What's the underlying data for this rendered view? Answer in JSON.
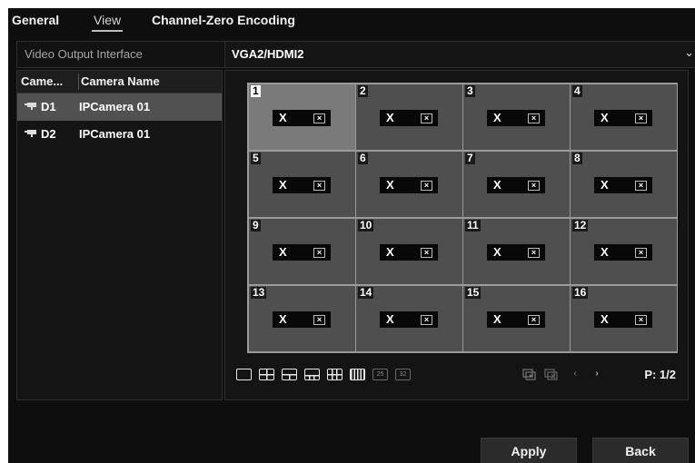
{
  "tabs": [
    {
      "label": "General"
    },
    {
      "label": "View"
    },
    {
      "label": "Channel-Zero Encoding"
    }
  ],
  "output": {
    "label": "Video Output Interface",
    "value": "VGA2/HDMI2"
  },
  "camera_list": {
    "col_no": "Came...",
    "col_name": "Camera Name",
    "rows": [
      {
        "id": "D1",
        "name": "IPCamera 01"
      },
      {
        "id": "D2",
        "name": "IPCamera 01"
      }
    ]
  },
  "grid": {
    "clear_symbol": "X",
    "cells": [
      {
        "num": "1"
      },
      {
        "num": "2"
      },
      {
        "num": "3"
      },
      {
        "num": "4"
      },
      {
        "num": "5"
      },
      {
        "num": "6"
      },
      {
        "num": "7"
      },
      {
        "num": "8"
      },
      {
        "num": "9"
      },
      {
        "num": "10"
      },
      {
        "num": "11"
      },
      {
        "num": "12"
      },
      {
        "num": "13"
      },
      {
        "num": "14"
      },
      {
        "num": "15"
      },
      {
        "num": "16"
      }
    ]
  },
  "layout_toolbar": {
    "buttons": [
      {
        "icon": "layout-1-icon"
      },
      {
        "icon": "layout-4-icon"
      },
      {
        "icon": "layout-6-icon"
      },
      {
        "icon": "layout-8-icon"
      },
      {
        "icon": "layout-9-icon"
      },
      {
        "icon": "layout-16-icon"
      },
      {
        "icon": "layout-25-icon",
        "label": "25"
      },
      {
        "icon": "layout-32-icon",
        "label": "32"
      }
    ],
    "page": "P: 1/2"
  },
  "buttons": {
    "apply": "Apply",
    "back": "Back"
  },
  "colors": {
    "background": "#0e0e0e",
    "cell": "#4f4f4f",
    "cell_selected": "#7a7a7a",
    "row_selected": "#515151"
  }
}
